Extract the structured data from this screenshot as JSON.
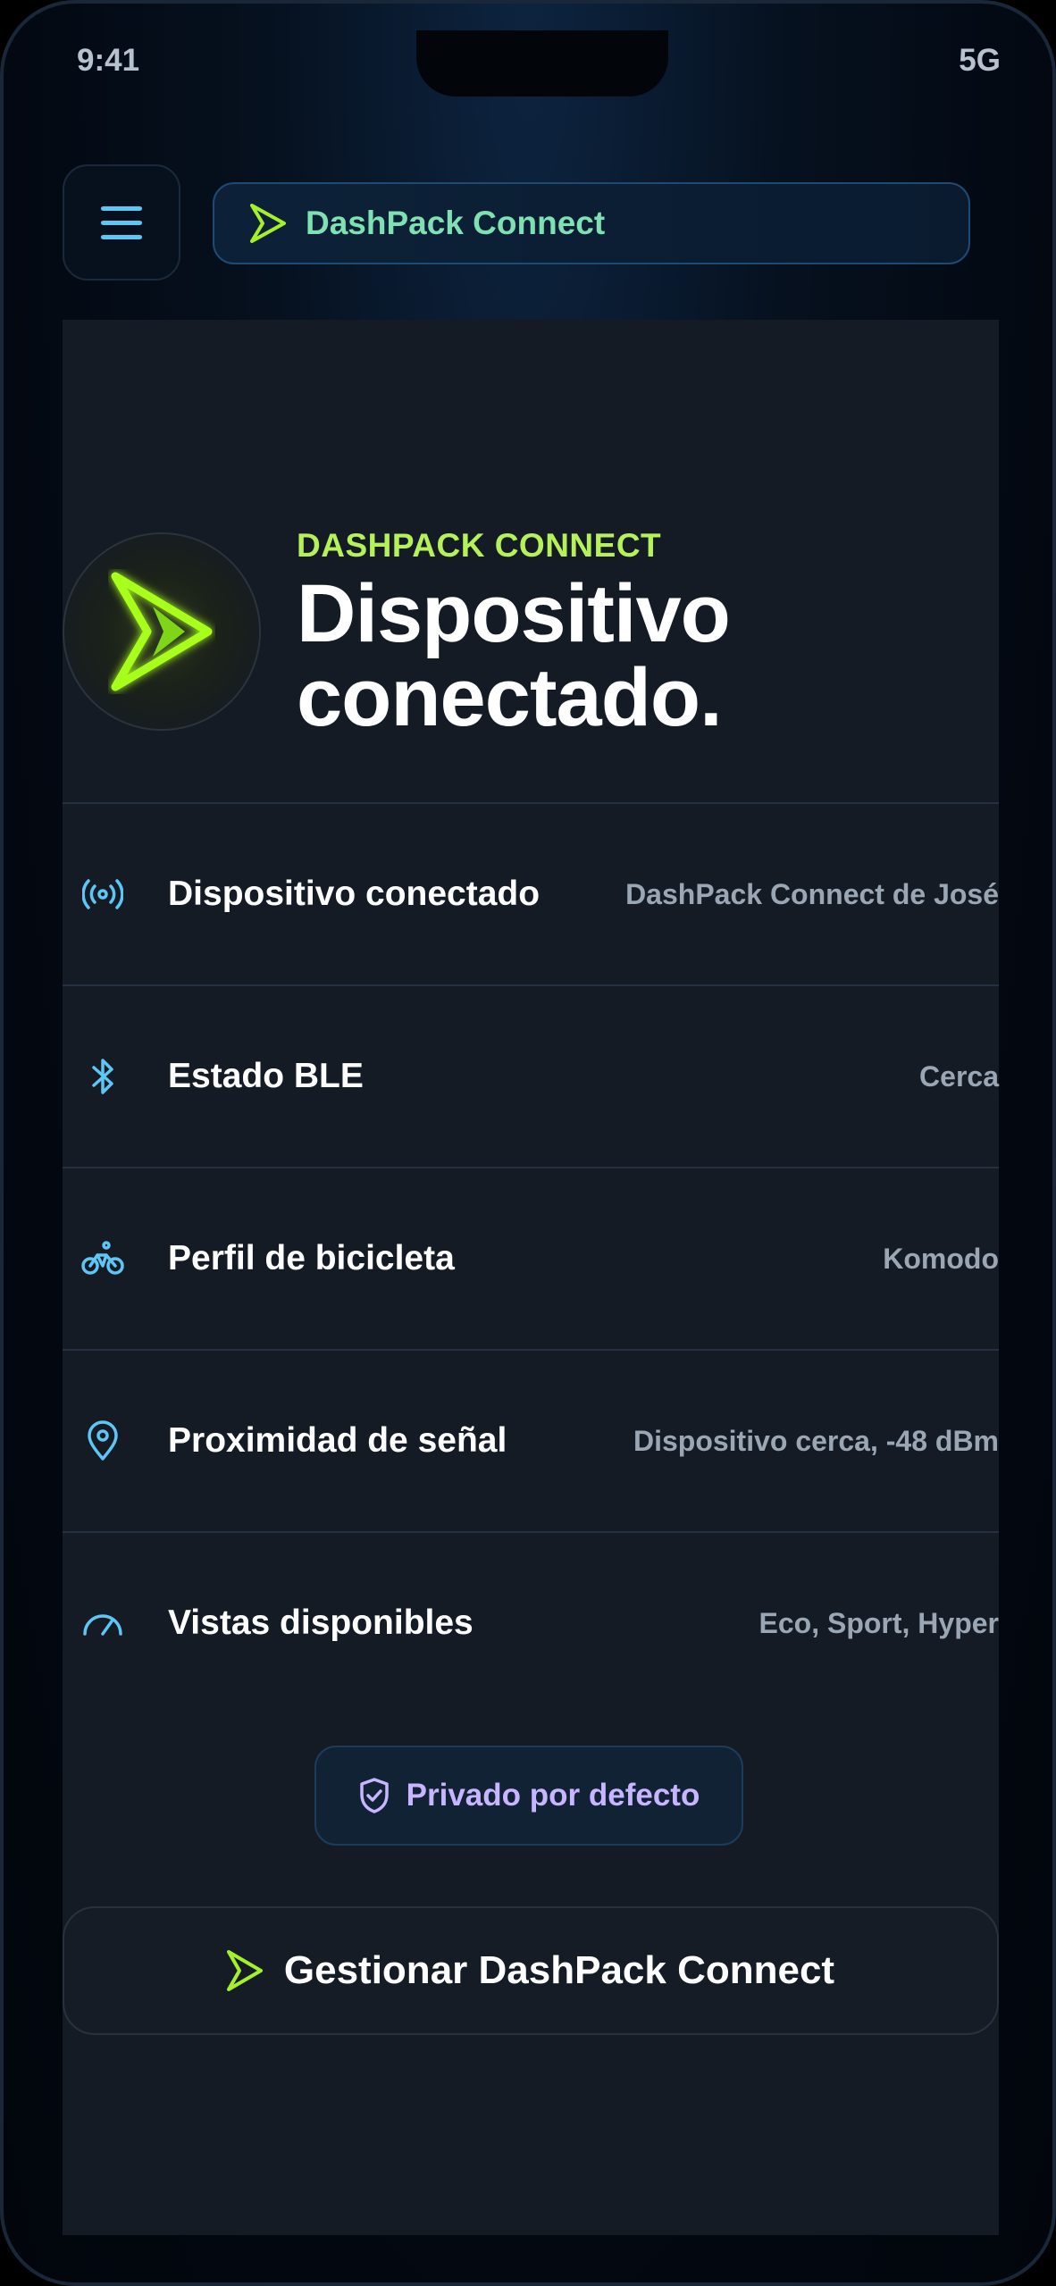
{
  "status_bar": {
    "time": "9:41",
    "network": "5G"
  },
  "header": {
    "title": "DashPack Connect"
  },
  "hero": {
    "kicker": "DASHPACK CONNECT",
    "title": "Dispositivo conectado."
  },
  "info_rows": [
    {
      "icon": "broadcast-icon",
      "label": "Dispositivo conectado",
      "value": "DashPack Connect de José"
    },
    {
      "icon": "bluetooth-icon",
      "label": "Estado BLE",
      "value": "Cerca"
    },
    {
      "icon": "bicycle-icon",
      "label": "Perfil de bicicleta",
      "value": "Komodo"
    },
    {
      "icon": "location-pin-icon",
      "label": "Proximidad de señal",
      "value": "Dispositivo cerca, -48 dBm"
    },
    {
      "icon": "gauge-icon",
      "label": "Vistas disponibles",
      "value": "Eco, Sport, Hyper"
    }
  ],
  "privacy_badge": {
    "label": "Privado por defecto"
  },
  "manage_button": {
    "label": "Gestionar DashPack Connect"
  },
  "colors": {
    "accent_green": "#b6f05a",
    "header_text": "#7ee0b3",
    "icon_blue": "#5ec6f4",
    "privacy_text": "#c8b5ff"
  }
}
